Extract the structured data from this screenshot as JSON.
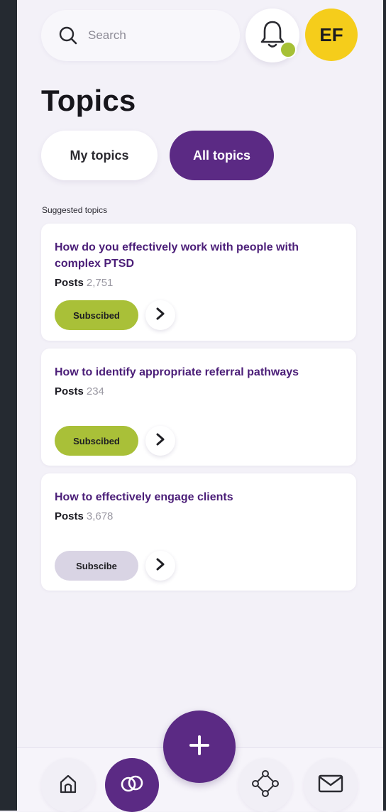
{
  "header": {
    "search": {
      "placeholder": "Search",
      "value": ""
    },
    "avatar": {
      "initials": "EF"
    },
    "notification_dot_color": "#a6c036"
  },
  "page": {
    "title": "Topics"
  },
  "tabs": [
    {
      "label": "My topics",
      "active": false
    },
    {
      "label": "All topics",
      "active": true
    }
  ],
  "section": {
    "label": "Suggested topics"
  },
  "topics": [
    {
      "title": "How do you effectively work with people with complex PTSD",
      "posts_label": "Posts",
      "posts_count": "2,751",
      "subscribe_label": "Subscibed",
      "subscribed": true
    },
    {
      "title": "How to identify appropriate referral pathways",
      "posts_label": "Posts",
      "posts_count": "234",
      "subscribe_label": "Subscibed",
      "subscribed": true
    },
    {
      "title": "How to effectively engage clients",
      "posts_label": "Posts",
      "posts_count": "3,678",
      "subscribe_label": "Subscibe",
      "subscribed": false
    }
  ],
  "bottom_nav": {
    "items": [
      {
        "icon": "home-icon",
        "active": false
      },
      {
        "icon": "links-icon",
        "active": true
      },
      {
        "icon": "network-icon",
        "active": false
      },
      {
        "icon": "mail-icon",
        "active": false
      }
    ],
    "fab_icon": "plus-icon"
  },
  "colors": {
    "accent": "#5b2a84",
    "subscribed": "#a9c038",
    "unsubscribed": "#d9d4e4",
    "avatar": "#f5cd1b",
    "background": "#f3f1f8"
  }
}
